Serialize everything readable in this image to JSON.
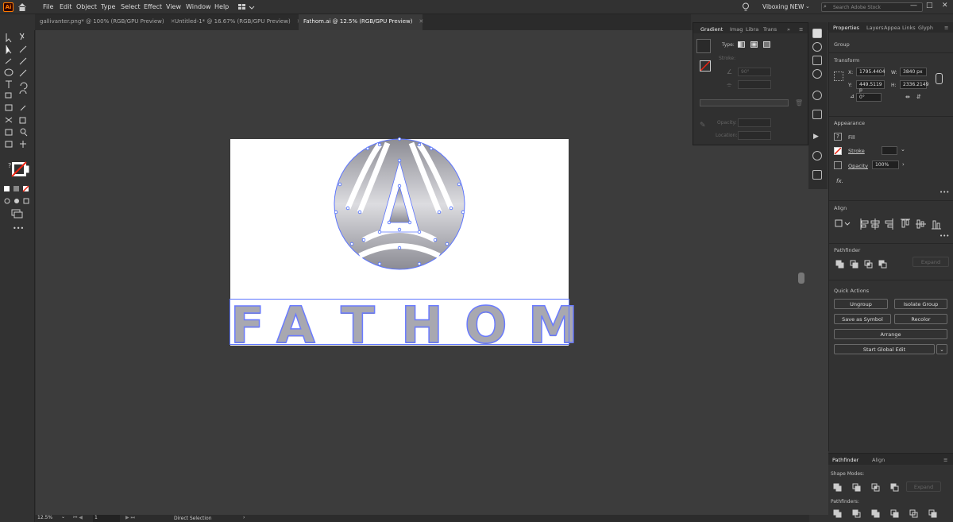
{
  "menubar": {
    "app_logo": "Ai",
    "items": [
      "File",
      "Edit",
      "Object",
      "Type",
      "Select",
      "Effect",
      "View",
      "Window",
      "Help"
    ],
    "workspace": "Viboxing NEW",
    "search_placeholder": "Search Adobe Stock"
  },
  "tabs": [
    {
      "label": "gallivanter.png* @ 100% (RGB/GPU Preview)"
    },
    {
      "label": "Untitled-1* @ 16.67% (RGB/GPU Preview)"
    },
    {
      "label": "Fathom.ai @ 12.5% (RGB/GPU Preview)"
    }
  ],
  "artwork": {
    "letters": [
      "F",
      "A",
      "T",
      "H",
      "O",
      "M"
    ]
  },
  "gradient_panel": {
    "tabs": [
      "Gradient",
      "Imag",
      "Libra",
      "Trans"
    ],
    "type_label": "Type:",
    "stroke_label": "Stroke:",
    "angle_value": "90°",
    "opacity_label": "Opacity:",
    "location_label": "Location:"
  },
  "properties": {
    "tabs": [
      "Properties",
      "Layers",
      "Appea",
      "Links",
      "Glyph"
    ],
    "selection_type": "Group",
    "transform": {
      "title": "Transform",
      "x_label": "X:",
      "x": "1795.4404",
      "y_label": "Y:",
      "y": "449.5119 p",
      "w_label": "W:",
      "w": "3840 px",
      "h_label": "H:",
      "h": "2336.2149",
      "angle": "0°"
    },
    "appearance": {
      "title": "Appearance",
      "fill": "Fill",
      "stroke": "Stroke",
      "opacity": "Opacity",
      "opacity_value": "100%",
      "fx": "fx."
    },
    "align_title": "Align",
    "pathfinder_title": "Pathfinder",
    "expand": "Expand",
    "quick_actions": {
      "title": "Quick Actions",
      "ungroup": "Ungroup",
      "isolate": "Isolate Group",
      "save_symbol": "Save as Symbol",
      "recolor": "Recolor",
      "arrange": "Arrange",
      "global_edit": "Start Global Edit"
    }
  },
  "pathfinder_panel": {
    "tabs": [
      "Pathfinder",
      "Align"
    ],
    "shape_modes": "Shape Modes:",
    "expand": "Expand",
    "pathfinders": "Pathfinders:"
  },
  "status": {
    "zoom": "12.5%",
    "artboard": "1",
    "tool": "Direct Selection"
  },
  "colors": {
    "accent": "#4a6bff",
    "ui_bg": "#323232",
    "canvas_bg": "#3c3c3c"
  }
}
